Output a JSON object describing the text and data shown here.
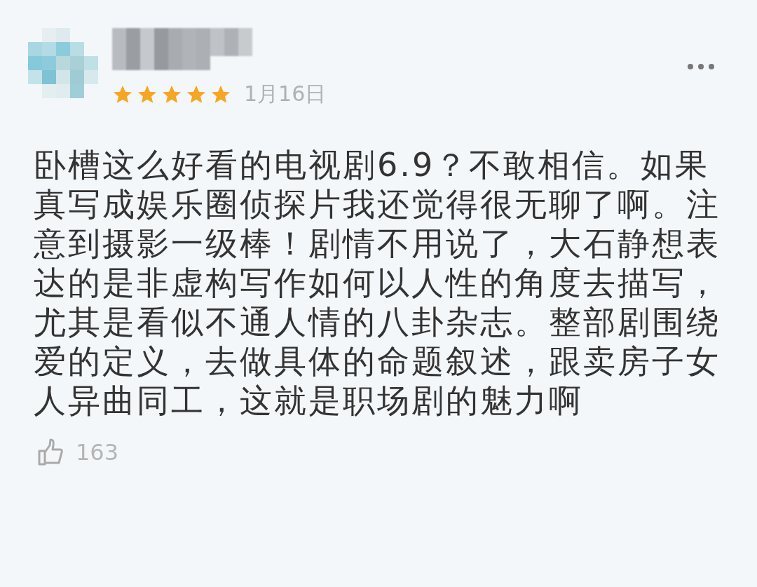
{
  "review": {
    "stars": 5,
    "date": "1月16日",
    "text": "卧槽这么好看的电视剧6.9？不敢相信。如果真写成娱乐圈侦探片我还觉得很无聊了啊。注意到摄影一级棒！剧情不用说了，大石静想表达的是非虚构写作如何以人性的角度去描写，尤其是看似不通人情的八卦杂志。整部剧围绕爱的定义，去做具体的命题叙述，跟卖房子女人异曲同工，这就是职场剧的魅力啊",
    "likes": "163"
  }
}
